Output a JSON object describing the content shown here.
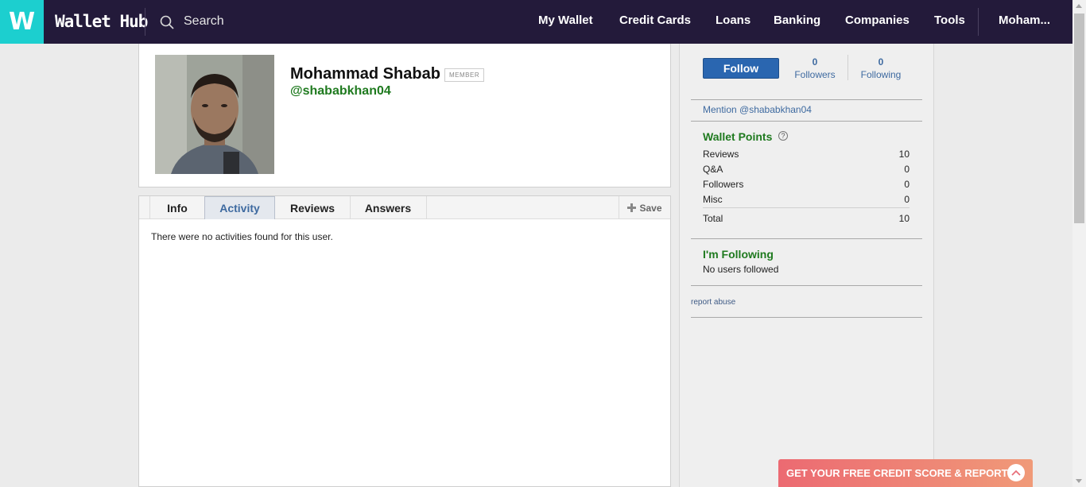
{
  "nav": {
    "logo_letter": "W",
    "brand": "Wallet Hub",
    "search_placeholder": "Search",
    "links": [
      "My Wallet",
      "Credit Cards",
      "Loans",
      "Banking",
      "Companies",
      "Tools"
    ],
    "user": "Moham..."
  },
  "profile": {
    "name": "Mohammad Shabab",
    "badge": "MEMBER",
    "handle": "@shababkhan04"
  },
  "tabs": {
    "items": [
      "Info",
      "Activity",
      "Reviews",
      "Answers"
    ],
    "active": "Activity",
    "save_label": "Save"
  },
  "activity": {
    "empty_message": "There were no activities found for this user."
  },
  "sidebar": {
    "follow_label": "Follow",
    "followers_count": "0",
    "followers_label": "Followers",
    "following_count": "0",
    "following_label": "Following",
    "mention": "Mention @shababkhan04",
    "wallet_points_title": "Wallet Points",
    "points": [
      {
        "label": "Reviews",
        "value": "10"
      },
      {
        "label": "Q&A",
        "value": "0"
      },
      {
        "label": "Followers",
        "value": "0"
      },
      {
        "label": "Misc",
        "value": "0"
      }
    ],
    "total_label": "Total",
    "total_value": "10",
    "following_title": "I'm Following",
    "no_users": "No users followed",
    "report": "report abuse"
  },
  "banner": {
    "text": "GET YOUR FREE CREDIT SCORE & REPORT"
  },
  "colors": {
    "nav_bg": "#231a3a",
    "logo_bg": "#1ccfcf",
    "accent_green": "#1f7a1f",
    "link_blue": "#3e6aa0",
    "follow_button": "#2a66b0"
  }
}
